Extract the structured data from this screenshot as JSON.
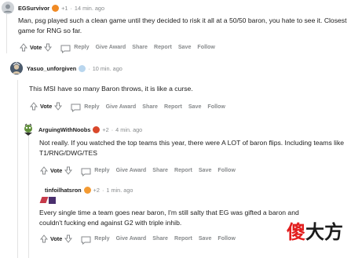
{
  "comments": [
    {
      "author": "EGSurvivor",
      "score": "+1",
      "time": "14 min. ago",
      "body": "Man, psg played such a clean game until they decided to risk it all at a 50/50 baron, you hate to see it. Closest game for RNG so far."
    },
    {
      "author": "Yasuo_unforgiven",
      "score": "",
      "time": "10 min. ago",
      "body": "This MSI have so many Baron throws, it is like a curse."
    },
    {
      "author": "ArguingWithNoobs",
      "score": "+2",
      "time": "4 min. ago",
      "body": "Not really. If you watched the top teams this year, there were A LOT of baron flips. Including teams like T1/RNG/DWG/TES"
    },
    {
      "author": "tinfoilhatsron",
      "score": "+2",
      "time": "1 min. ago",
      "body": "Every single time a team goes near baron, I'm still salty that EG was gifted a baron and couldn't fucking end against G2 with triple inhib."
    }
  ],
  "actions": {
    "vote": "Vote",
    "reply": "Reply",
    "give_award": "Give Award",
    "share": "Share",
    "report": "Report",
    "save": "Save",
    "follow": "Follow"
  },
  "separator": "·",
  "watermark": {
    "part1": "傻",
    "part2": "大方"
  },
  "colors": {
    "text": "#1c1c1c",
    "muted": "#878a8c",
    "thread_line": "#e3e3e3",
    "watermark_red": "#e21d1d"
  },
  "icons": [
    "upvote-arrow-icon",
    "downvote-arrow-icon",
    "reply-bubble-icon",
    "pumpkin-flair-icon",
    "cat-flair-icon"
  ]
}
